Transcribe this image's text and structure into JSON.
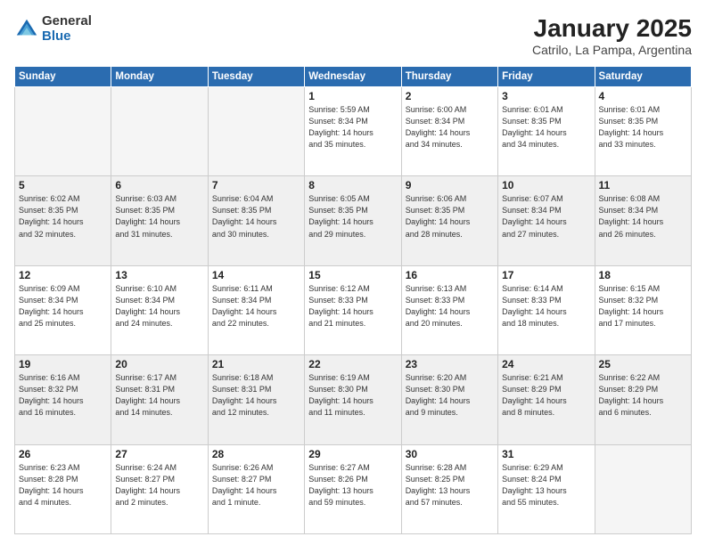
{
  "logo": {
    "general": "General",
    "blue": "Blue"
  },
  "title": "January 2025",
  "subtitle": "Catrilo, La Pampa, Argentina",
  "days_of_week": [
    "Sunday",
    "Monday",
    "Tuesday",
    "Wednesday",
    "Thursday",
    "Friday",
    "Saturday"
  ],
  "weeks": [
    [
      {
        "day": "",
        "info": "",
        "empty": true
      },
      {
        "day": "",
        "info": "",
        "empty": true
      },
      {
        "day": "",
        "info": "",
        "empty": true
      },
      {
        "day": "1",
        "info": "Sunrise: 5:59 AM\nSunset: 8:34 PM\nDaylight: 14 hours\nand 35 minutes."
      },
      {
        "day": "2",
        "info": "Sunrise: 6:00 AM\nSunset: 8:34 PM\nDaylight: 14 hours\nand 34 minutes."
      },
      {
        "day": "3",
        "info": "Sunrise: 6:01 AM\nSunset: 8:35 PM\nDaylight: 14 hours\nand 34 minutes."
      },
      {
        "day": "4",
        "info": "Sunrise: 6:01 AM\nSunset: 8:35 PM\nDaylight: 14 hours\nand 33 minutes."
      }
    ],
    [
      {
        "day": "5",
        "info": "Sunrise: 6:02 AM\nSunset: 8:35 PM\nDaylight: 14 hours\nand 32 minutes."
      },
      {
        "day": "6",
        "info": "Sunrise: 6:03 AM\nSunset: 8:35 PM\nDaylight: 14 hours\nand 31 minutes."
      },
      {
        "day": "7",
        "info": "Sunrise: 6:04 AM\nSunset: 8:35 PM\nDaylight: 14 hours\nand 30 minutes."
      },
      {
        "day": "8",
        "info": "Sunrise: 6:05 AM\nSunset: 8:35 PM\nDaylight: 14 hours\nand 29 minutes."
      },
      {
        "day": "9",
        "info": "Sunrise: 6:06 AM\nSunset: 8:35 PM\nDaylight: 14 hours\nand 28 minutes."
      },
      {
        "day": "10",
        "info": "Sunrise: 6:07 AM\nSunset: 8:34 PM\nDaylight: 14 hours\nand 27 minutes."
      },
      {
        "day": "11",
        "info": "Sunrise: 6:08 AM\nSunset: 8:34 PM\nDaylight: 14 hours\nand 26 minutes."
      }
    ],
    [
      {
        "day": "12",
        "info": "Sunrise: 6:09 AM\nSunset: 8:34 PM\nDaylight: 14 hours\nand 25 minutes."
      },
      {
        "day": "13",
        "info": "Sunrise: 6:10 AM\nSunset: 8:34 PM\nDaylight: 14 hours\nand 24 minutes."
      },
      {
        "day": "14",
        "info": "Sunrise: 6:11 AM\nSunset: 8:34 PM\nDaylight: 14 hours\nand 22 minutes."
      },
      {
        "day": "15",
        "info": "Sunrise: 6:12 AM\nSunset: 8:33 PM\nDaylight: 14 hours\nand 21 minutes."
      },
      {
        "day": "16",
        "info": "Sunrise: 6:13 AM\nSunset: 8:33 PM\nDaylight: 14 hours\nand 20 minutes."
      },
      {
        "day": "17",
        "info": "Sunrise: 6:14 AM\nSunset: 8:33 PM\nDaylight: 14 hours\nand 18 minutes."
      },
      {
        "day": "18",
        "info": "Sunrise: 6:15 AM\nSunset: 8:32 PM\nDaylight: 14 hours\nand 17 minutes."
      }
    ],
    [
      {
        "day": "19",
        "info": "Sunrise: 6:16 AM\nSunset: 8:32 PM\nDaylight: 14 hours\nand 16 minutes."
      },
      {
        "day": "20",
        "info": "Sunrise: 6:17 AM\nSunset: 8:31 PM\nDaylight: 14 hours\nand 14 minutes."
      },
      {
        "day": "21",
        "info": "Sunrise: 6:18 AM\nSunset: 8:31 PM\nDaylight: 14 hours\nand 12 minutes."
      },
      {
        "day": "22",
        "info": "Sunrise: 6:19 AM\nSunset: 8:30 PM\nDaylight: 14 hours\nand 11 minutes."
      },
      {
        "day": "23",
        "info": "Sunrise: 6:20 AM\nSunset: 8:30 PM\nDaylight: 14 hours\nand 9 minutes."
      },
      {
        "day": "24",
        "info": "Sunrise: 6:21 AM\nSunset: 8:29 PM\nDaylight: 14 hours\nand 8 minutes."
      },
      {
        "day": "25",
        "info": "Sunrise: 6:22 AM\nSunset: 8:29 PM\nDaylight: 14 hours\nand 6 minutes."
      }
    ],
    [
      {
        "day": "26",
        "info": "Sunrise: 6:23 AM\nSunset: 8:28 PM\nDaylight: 14 hours\nand 4 minutes."
      },
      {
        "day": "27",
        "info": "Sunrise: 6:24 AM\nSunset: 8:27 PM\nDaylight: 14 hours\nand 2 minutes."
      },
      {
        "day": "28",
        "info": "Sunrise: 6:26 AM\nSunset: 8:27 PM\nDaylight: 14 hours\nand 1 minute."
      },
      {
        "day": "29",
        "info": "Sunrise: 6:27 AM\nSunset: 8:26 PM\nDaylight: 13 hours\nand 59 minutes."
      },
      {
        "day": "30",
        "info": "Sunrise: 6:28 AM\nSunset: 8:25 PM\nDaylight: 13 hours\nand 57 minutes."
      },
      {
        "day": "31",
        "info": "Sunrise: 6:29 AM\nSunset: 8:24 PM\nDaylight: 13 hours\nand 55 minutes."
      },
      {
        "day": "",
        "info": "",
        "empty": true
      }
    ]
  ]
}
